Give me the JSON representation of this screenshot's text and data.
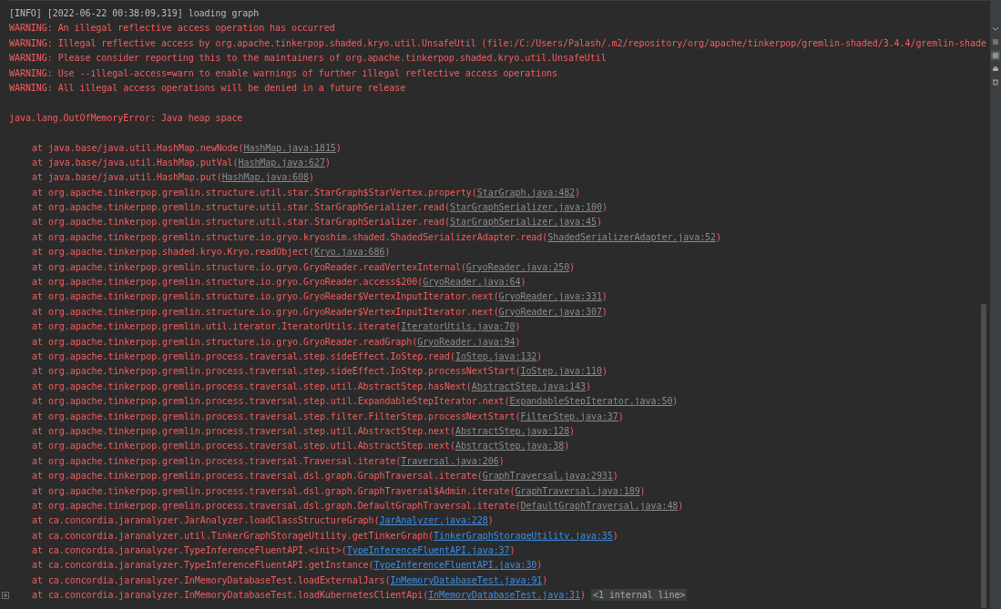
{
  "console": {
    "lines": [
      {
        "kind": "info",
        "text": "[INFO] [2022-06-22 00:38:09,319] loading graph"
      },
      {
        "kind": "warning",
        "text": "WARNING: An illegal reflective access operation has occurred"
      },
      {
        "kind": "warning",
        "text": "WARNING: Illegal reflective access by org.apache.tinkerpop.shaded.kryo.util.UnsafeUtil (file:/C:/Users/Palash/.m2/repository/org/apache/tinkerpop/gremlin-shaded/3.4.4/gremlin-shade"
      },
      {
        "kind": "warning",
        "text": "WARNING: Please consider reporting this to the maintainers of org.apache.tinkerpop.shaded.kryo.util.UnsafeUtil"
      },
      {
        "kind": "warning",
        "text": "WARNING: Use --illegal-access=warn to enable warnings of further illegal reflective access operations"
      },
      {
        "kind": "warning",
        "text": "WARNING: All illegal access operations will be denied in a future release"
      },
      {
        "kind": "blank"
      },
      {
        "kind": "warning",
        "text": "java.lang.OutOfMemoryError: Java heap space"
      },
      {
        "kind": "blank"
      },
      {
        "kind": "frame",
        "text": "at java.base/java.util.HashMap.newNode(",
        "link": "HashMap.java:1815",
        "in_project": false,
        "suffix": ")"
      },
      {
        "kind": "frame",
        "text": "at java.base/java.util.HashMap.putVal(",
        "link": "HashMap.java:627",
        "in_project": false,
        "suffix": ")"
      },
      {
        "kind": "frame",
        "text": "at java.base/java.util.HashMap.put(",
        "link": "HashMap.java:608",
        "in_project": false,
        "suffix": ")"
      },
      {
        "kind": "frame",
        "text": "at org.apache.tinkerpop.gremlin.structure.util.star.StarGraph$StarVertex.property(",
        "link": "StarGraph.java:482",
        "in_project": false,
        "suffix": ")"
      },
      {
        "kind": "frame",
        "text": "at org.apache.tinkerpop.gremlin.structure.util.star.StarGraphSerializer.read(",
        "link": "StarGraphSerializer.java:100",
        "in_project": false,
        "suffix": ")"
      },
      {
        "kind": "frame",
        "text": "at org.apache.tinkerpop.gremlin.structure.util.star.StarGraphSerializer.read(",
        "link": "StarGraphSerializer.java:45",
        "in_project": false,
        "suffix": ")"
      },
      {
        "kind": "frame",
        "text": "at org.apache.tinkerpop.gremlin.structure.io.gryo.kryoshim.shaded.ShadedSerializerAdapter.read(",
        "link": "ShadedSerializerAdapter.java:52",
        "in_project": false,
        "suffix": ")"
      },
      {
        "kind": "frame",
        "text": "at org.apache.tinkerpop.shaded.kryo.Kryo.readObject(",
        "link": "Kryo.java:686",
        "in_project": false,
        "suffix": ")"
      },
      {
        "kind": "frame",
        "text": "at org.apache.tinkerpop.gremlin.structure.io.gryo.GryoReader.readVertexInternal(",
        "link": "GryoReader.java:250",
        "in_project": false,
        "suffix": ")"
      },
      {
        "kind": "frame",
        "text": "at org.apache.tinkerpop.gremlin.structure.io.gryo.GryoReader.access$200(",
        "link": "GryoReader.java:64",
        "in_project": false,
        "suffix": ")"
      },
      {
        "kind": "frame",
        "text": "at org.apache.tinkerpop.gremlin.structure.io.gryo.GryoReader$VertexInputIterator.next(",
        "link": "GryoReader.java:331",
        "in_project": false,
        "suffix": ")"
      },
      {
        "kind": "frame",
        "text": "at org.apache.tinkerpop.gremlin.structure.io.gryo.GryoReader$VertexInputIterator.next(",
        "link": "GryoReader.java:307",
        "in_project": false,
        "suffix": ")"
      },
      {
        "kind": "frame",
        "text": "at org.apache.tinkerpop.gremlin.util.iterator.IteratorUtils.iterate(",
        "link": "IteratorUtils.java:70",
        "in_project": false,
        "suffix": ")"
      },
      {
        "kind": "frame",
        "text": "at org.apache.tinkerpop.gremlin.structure.io.gryo.GryoReader.readGraph(",
        "link": "GryoReader.java:94",
        "in_project": false,
        "suffix": ")"
      },
      {
        "kind": "frame",
        "text": "at org.apache.tinkerpop.gremlin.process.traversal.step.sideEffect.IoStep.read(",
        "link": "IoStep.java:132",
        "in_project": false,
        "suffix": ")"
      },
      {
        "kind": "frame",
        "text": "at org.apache.tinkerpop.gremlin.process.traversal.step.sideEffect.IoStep.processNextStart(",
        "link": "IoStep.java:110",
        "in_project": false,
        "suffix": ")"
      },
      {
        "kind": "frame",
        "text": "at org.apache.tinkerpop.gremlin.process.traversal.step.util.AbstractStep.hasNext(",
        "link": "AbstractStep.java:143",
        "in_project": false,
        "suffix": ")"
      },
      {
        "kind": "frame",
        "text": "at org.apache.tinkerpop.gremlin.process.traversal.step.util.ExpandableStepIterator.next(",
        "link": "ExpandableStepIterator.java:50",
        "in_project": false,
        "suffix": ")"
      },
      {
        "kind": "frame",
        "text": "at org.apache.tinkerpop.gremlin.process.traversal.step.filter.FilterStep.processNextStart(",
        "link": "FilterStep.java:37",
        "in_project": false,
        "suffix": ")"
      },
      {
        "kind": "frame",
        "text": "at org.apache.tinkerpop.gremlin.process.traversal.step.util.AbstractStep.next(",
        "link": "AbstractStep.java:128",
        "in_project": false,
        "suffix": ")"
      },
      {
        "kind": "frame",
        "text": "at org.apache.tinkerpop.gremlin.process.traversal.step.util.AbstractStep.next(",
        "link": "AbstractStep.java:38",
        "in_project": false,
        "suffix": ")"
      },
      {
        "kind": "frame",
        "text": "at org.apache.tinkerpop.gremlin.process.traversal.Traversal.iterate(",
        "link": "Traversal.java:206",
        "in_project": false,
        "suffix": ")"
      },
      {
        "kind": "frame",
        "text": "at org.apache.tinkerpop.gremlin.process.traversal.dsl.graph.GraphTraversal.iterate(",
        "link": "GraphTraversal.java:2931",
        "in_project": false,
        "suffix": ")"
      },
      {
        "kind": "frame",
        "text": "at org.apache.tinkerpop.gremlin.process.traversal.dsl.graph.GraphTraversal$Admin.iterate(",
        "link": "GraphTraversal.java:189",
        "in_project": false,
        "suffix": ")"
      },
      {
        "kind": "frame",
        "text": "at org.apache.tinkerpop.gremlin.process.traversal.dsl.graph.DefaultGraphTraversal.iterate(",
        "link": "DefaultGraphTraversal.java:48",
        "in_project": false,
        "suffix": ")"
      },
      {
        "kind": "frame",
        "text": "at ca.concordia.jaranalyzer.JarAnalyzer.loadClassStructureGraph(",
        "link": "JarAnalyzer.java:228",
        "in_project": true,
        "suffix": ")"
      },
      {
        "kind": "frame",
        "text": "at ca.concordia.jaranalyzer.util.TinkerGraphStorageUtility.getTinkerGraph(",
        "link": "TinkerGraphStorageUtility.java:35",
        "in_project": true,
        "suffix": ")"
      },
      {
        "kind": "frame",
        "text": "at ca.concordia.jaranalyzer.TypeInferenceFluentAPI.<init>(",
        "link": "TypeInferenceFluentAPI.java:37",
        "in_project": true,
        "suffix": ")"
      },
      {
        "kind": "frame",
        "text": "at ca.concordia.jaranalyzer.TypeInferenceFluentAPI.getInstance(",
        "link": "TypeInferenceFluentAPI.java:30",
        "in_project": true,
        "suffix": ")"
      },
      {
        "kind": "frame",
        "text": "at ca.concordia.jaranalyzer.InMemoryDatabaseTest.loadExternalJars(",
        "link": "InMemoryDatabaseTest.java:91",
        "in_project": true,
        "suffix": ")"
      },
      {
        "kind": "frame",
        "text": "at ca.concordia.jaranalyzer.InMemoryDatabaseTest.loadKubernetesClientApi(",
        "link": "InMemoryDatabaseTest.java:31",
        "in_project": true,
        "suffix": ")",
        "folded": "<1 internal line>"
      }
    ]
  }
}
